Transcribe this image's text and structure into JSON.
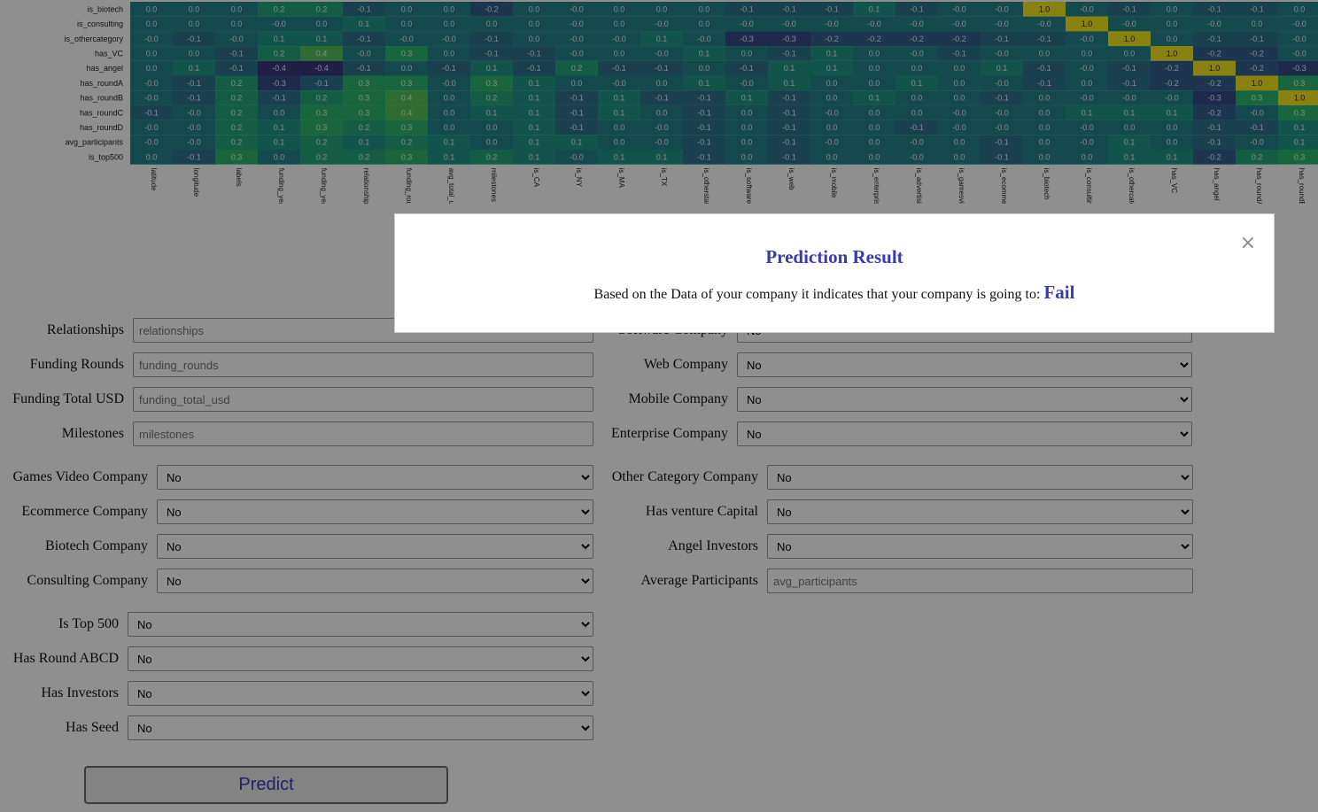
{
  "heatmap": {
    "row_labels": [
      "is_biotech",
      "is_consulting",
      "is_othercategory",
      "has_VC",
      "has_angel",
      "has_roundA",
      "has_roundB",
      "has_roundC",
      "has_roundD",
      "avg_participants",
      "is_top500"
    ],
    "col_labels": [
      "latitude",
      "longitude",
      "labels",
      "funding_year",
      "funding_year",
      "relationships",
      "funding_rounds",
      "avg_total_usd",
      "milestones",
      "is_CA",
      "is_NY",
      "is_MA",
      "is_TX",
      "is_otherstate",
      "is_software",
      "is_web",
      "is_mobile",
      "is_enterprise",
      "is_advertising",
      "is_gamesvideo",
      "is_ecommerce",
      "is_biotech",
      "is_consulting",
      "is_othercategory",
      "has_VC",
      "has_angel",
      "has_roundA",
      "has_roundB"
    ],
    "values": [
      [
        "0.0",
        "0.0",
        "0.0",
        "0.2",
        "0.2",
        "-0.1",
        "0.0",
        "0.0",
        "-0.2",
        "0.0",
        "-0.0",
        "0.0",
        "0.0",
        "0.0",
        "-0.1",
        "-0.1",
        "-0.1",
        "0.1",
        "-0.1",
        "-0.0",
        "-0.0",
        "1.0",
        "-0.0",
        "-0.1",
        "0.0",
        "-0.1",
        "-0.1",
        "0.0"
      ],
      [
        "0.0",
        "0.0",
        "0.0",
        "-0.0",
        "0.0",
        "0.1",
        "0.0",
        "0.0",
        "0.0",
        "0.0",
        "-0.0",
        "0.0",
        "-0.0",
        "0.0",
        "-0.0",
        "-0.0",
        "-0.0",
        "-0.0",
        "-0.0",
        "-0.0",
        "-0.0",
        "-0.0",
        "1.0",
        "-0.0",
        "0.0",
        "-0.0",
        "0.0",
        "-0.0"
      ],
      [
        "-0.0",
        "-0.1",
        "-0.0",
        "0.1",
        "0.1",
        "-0.1",
        "-0.0",
        "-0.0",
        "-0.1",
        "0.0",
        "-0.0",
        "-0.0",
        "0.1",
        "-0.0",
        "-0.3",
        "-0.3",
        "-0.2",
        "-0.2",
        "-0.2",
        "-0.2",
        "-0.1",
        "-0.1",
        "-0.0",
        "1.0",
        "0.0",
        "-0.1",
        "-0.1",
        "-0.0"
      ],
      [
        "0.0",
        "0.0",
        "-0.1",
        "0.2",
        "0.4",
        "-0.0",
        "0.3",
        "0.0",
        "-0.1",
        "-0.1",
        "-0.0",
        "0.0",
        "-0.0",
        "0.1",
        "0.0",
        "-0.1",
        "0.1",
        "0.0",
        "-0.0",
        "-0.1",
        "-0.0",
        "0.0",
        "0.0",
        "0.0",
        "1.0",
        "-0.2",
        "-0.2",
        "-0.0"
      ],
      [
        "0.0",
        "0.1",
        "-0.1",
        "-0.4",
        "-0.4",
        "-0.1",
        "0.0",
        "-0.1",
        "0.1",
        "-0.1",
        "0.2",
        "-0.1",
        "-0.1",
        "0.0",
        "-0.1",
        "0.1",
        "0.1",
        "0.0",
        "0.0",
        "0.0",
        "0.1",
        "-0.1",
        "-0.0",
        "-0.1",
        "-0.2",
        "1.0",
        "-0.2",
        "-0.3"
      ],
      [
        "-0.0",
        "-0.1",
        "0.2",
        "-0.3",
        "-0.1",
        "0.3",
        "0.3",
        "-0.0",
        "0.3",
        "0.1",
        "0.0",
        "-0.0",
        "0.0",
        "0.1",
        "-0.0",
        "0.1",
        "0.0",
        "0.0",
        "0.1",
        "0.0",
        "-0.0",
        "-0.1",
        "0.0",
        "-0.1",
        "-0.2",
        "-0.2",
        "1.0",
        "0.3"
      ],
      [
        "-0.0",
        "-0.1",
        "0.2",
        "-0.1",
        "0.2",
        "0.3",
        "0.4",
        "0.0",
        "0.2",
        "0.1",
        "-0.1",
        "0.1",
        "-0.1",
        "-0.1",
        "0.1",
        "-0.1",
        "0.0",
        "0.1",
        "0.0",
        "0.0",
        "-0.1",
        "0.0",
        "-0.0",
        "-0.0",
        "-0.0",
        "-0.3",
        "0.3",
        "1.0"
      ],
      [
        "-0.1",
        "-0.0",
        "0.2",
        "0.0",
        "0.3",
        "0.3",
        "0.4",
        "0.0",
        "0.1",
        "0.1",
        "-0.1",
        "0.1",
        "0.0",
        "-0.1",
        "0.0",
        "-0.1",
        "-0.0",
        "0.0",
        "0.0",
        "-0.0",
        "-0.0",
        "0.0",
        "0.1",
        "0.1",
        "0.1",
        "-0.2",
        "-0.0",
        "0.3"
      ],
      [
        "-0.0",
        "-0.0",
        "0.2",
        "0.1",
        "0.3",
        "0.2",
        "0.3",
        "0.0",
        "0.0",
        "0.1",
        "-0.1",
        "0.0",
        "-0.0",
        "-0.1",
        "0.0",
        "-0.1",
        "0.0",
        "0.0",
        "-0.1",
        "-0.0",
        "-0.0",
        "0.0",
        "-0.0",
        "0.0",
        "0.0",
        "-0.1",
        "-0.1",
        "0.1"
      ],
      [
        "-0.0",
        "-0.0",
        "0.2",
        "0.1",
        "0.2",
        "0.1",
        "0.2",
        "0.1",
        "0.0",
        "0.1",
        "0.1",
        "0.0",
        "-0.0",
        "-0.1",
        "0.0",
        "-0.1",
        "-0.0",
        "0.0",
        "-0.0",
        "0.0",
        "-0.1",
        "0.0",
        "-0.0",
        "0.1",
        "0.0",
        "-0.1",
        "-0.0",
        "0.1"
      ],
      [
        "0.0",
        "-0.1",
        "0.3",
        "0.0",
        "0.2",
        "0.2",
        "0.3",
        "0.1",
        "0.2",
        "0.1",
        "-0.0",
        "0.1",
        "0.1",
        "-0.1",
        "0.0",
        "-0.1",
        "0.0",
        "0.0",
        "-0.0",
        "0.0",
        "-0.1",
        "0.0",
        "0.0",
        "0.1",
        "0.1",
        "-0.2",
        "0.2",
        "0.3"
      ]
    ]
  },
  "form": {
    "relationships": {
      "label": "Relationships",
      "placeholder": "relationships"
    },
    "funding_rounds": {
      "label": "Funding Rounds",
      "placeholder": "funding_rounds"
    },
    "funding_total_usd": {
      "label": "Funding Total USD",
      "placeholder": "funding_total_usd"
    },
    "milestones": {
      "label": "Milestones",
      "placeholder": "milestones"
    },
    "software_company": {
      "label": "Software Company",
      "value": "No"
    },
    "web_company": {
      "label": "Web Company",
      "value": "No"
    },
    "mobile_company": {
      "label": "Mobile Company",
      "value": "No"
    },
    "enterprise_company": {
      "label": "Enterprise Company",
      "value": "No"
    },
    "games_video_company": {
      "label": "Games Video Company",
      "value": "No"
    },
    "ecommerce_company": {
      "label": "Ecommerce Company",
      "value": "No"
    },
    "biotech_company": {
      "label": "Biotech Company",
      "value": "No"
    },
    "consulting_company": {
      "label": "Consulting Company",
      "value": "No"
    },
    "other_category_company": {
      "label": "Other Category Company",
      "value": "No"
    },
    "has_venture_capital": {
      "label": "Has venture Capital",
      "value": "No"
    },
    "angel_investors": {
      "label": "Angel Investors",
      "value": "No"
    },
    "average_participants": {
      "label": "Average Participants",
      "placeholder": "avg_participants"
    },
    "is_top_500": {
      "label": "Is Top 500",
      "value": "No"
    },
    "has_round_abcd": {
      "label": "Has Round ABCD",
      "value": "No"
    },
    "has_investors": {
      "label": "Has Investors",
      "value": "No"
    },
    "has_seed": {
      "label": "Has Seed",
      "value": "No"
    },
    "predict_label": "Predict"
  },
  "modal": {
    "title": "Prediction Result",
    "text": "Based on the Data of your company it indicates that your company is going to:",
    "result": "Fail",
    "close_symbol": "×"
  }
}
